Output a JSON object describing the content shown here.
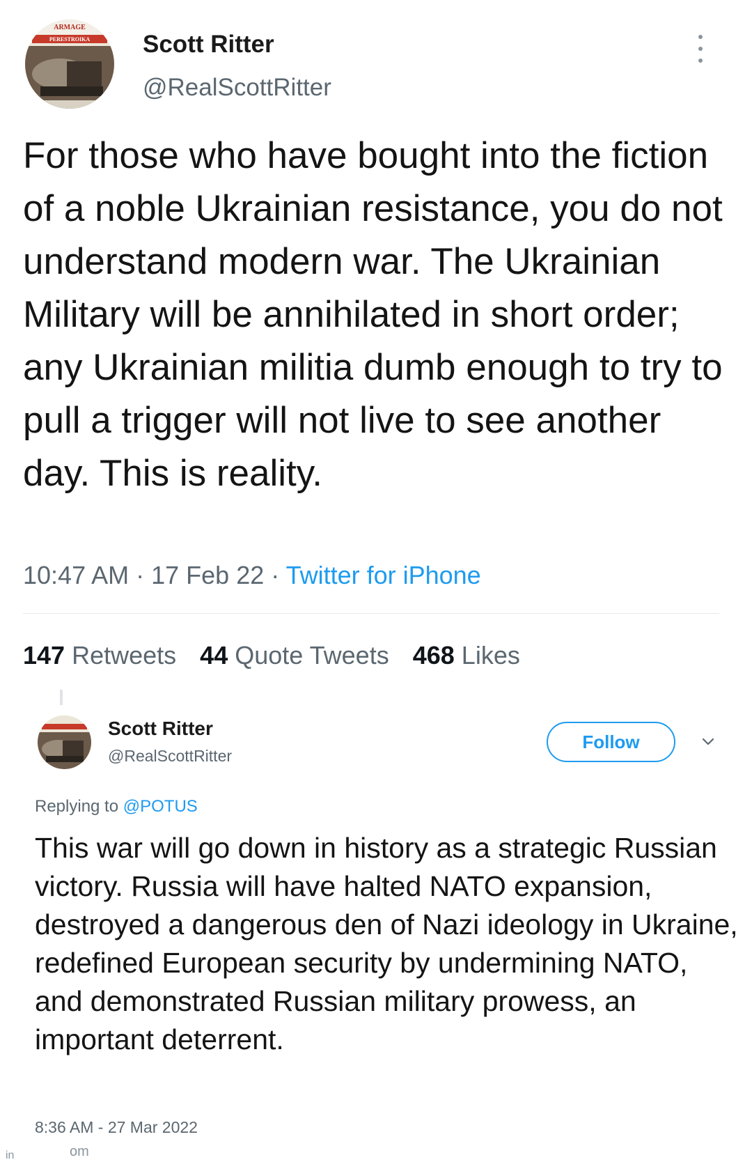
{
  "tweet1": {
    "name": "Scott Ritter",
    "handle": "@RealScottRitter",
    "avatar_label_top": "ARMAGE",
    "avatar_label_mid": "PERESTROIKA",
    "text": "For those who have bought into the fiction of a noble Ukrainian resistance, you do not understand modern war. The Ukrainian Military will be annihilated in short order; any Ukrainian militia dumb enough to try to pull a trigger will not live to see another day. This is reality.",
    "time": "10:47 AM",
    "date": "17 Feb 22",
    "client": "Twitter for iPhone",
    "sep": " · ",
    "stats": {
      "retweets_count": "147",
      "retweets_label": "Retweets",
      "quotes_count": "44",
      "quotes_label": "Quote Tweets",
      "likes_count": "468",
      "likes_label": "Likes"
    }
  },
  "tweet2": {
    "name": "Scott Ritter",
    "handle": "@RealScottRitter",
    "follow_label": "Follow",
    "replying_prefix": "Replying to ",
    "replying_to": "@POTUS",
    "text": "This war will go down in history as a strategic Russian victory. Russia will have halted NATO expansion, destroyed a dangerous den of Nazi ideology in Ukraine, redefined European security by undermining NATO, and demonstrated Russian military prowess, an important deterrent.",
    "meta": "8:36 AM - 27 Mar 2022",
    "cut_text": "om"
  },
  "corner_text": "in",
  "colors": {
    "accent": "#1d9bf0",
    "text": "#0f1419",
    "secondary": "#5b6770"
  },
  "icons": [
    "more-icon",
    "chevron-down-icon",
    "avatar"
  ]
}
